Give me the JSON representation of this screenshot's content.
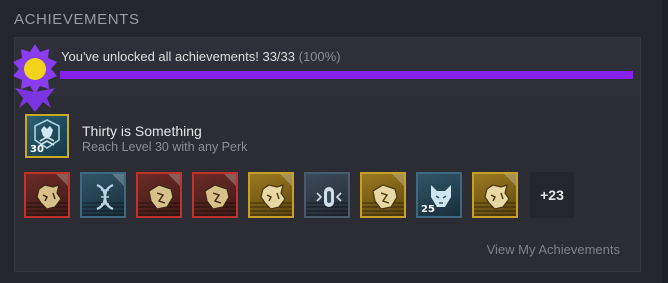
{
  "section": {
    "title": "ACHIEVEMENTS"
  },
  "unlock": {
    "message": "You've unlocked all achievements! 33/33",
    "percent_label": "(100%)",
    "progress_fraction": 1.0,
    "bar_color": "#8521ea"
  },
  "featured": {
    "title": "Thirty is Something",
    "description": "Reach Level 30 with any Perk",
    "badge_number": "30",
    "icon": "wolf-rank-icon"
  },
  "achievements": [
    {
      "style": "red",
      "icon": "beast-head-icon"
    },
    {
      "style": "blue",
      "icon": "dna-helix-icon"
    },
    {
      "style": "red",
      "icon": "beast-head-icon"
    },
    {
      "style": "red",
      "icon": "beast-head-icon"
    },
    {
      "style": "gold",
      "icon": "beast-head-icon"
    },
    {
      "style": "slate",
      "icon": "capsule-icon"
    },
    {
      "style": "gold",
      "icon": "beast-head-icon"
    },
    {
      "style": "blue",
      "icon": "wolf-head-icon",
      "number": "25"
    },
    {
      "style": "gold",
      "icon": "beast-head-icon"
    }
  ],
  "more_count": "+23",
  "view_link": "View My Achievements"
}
